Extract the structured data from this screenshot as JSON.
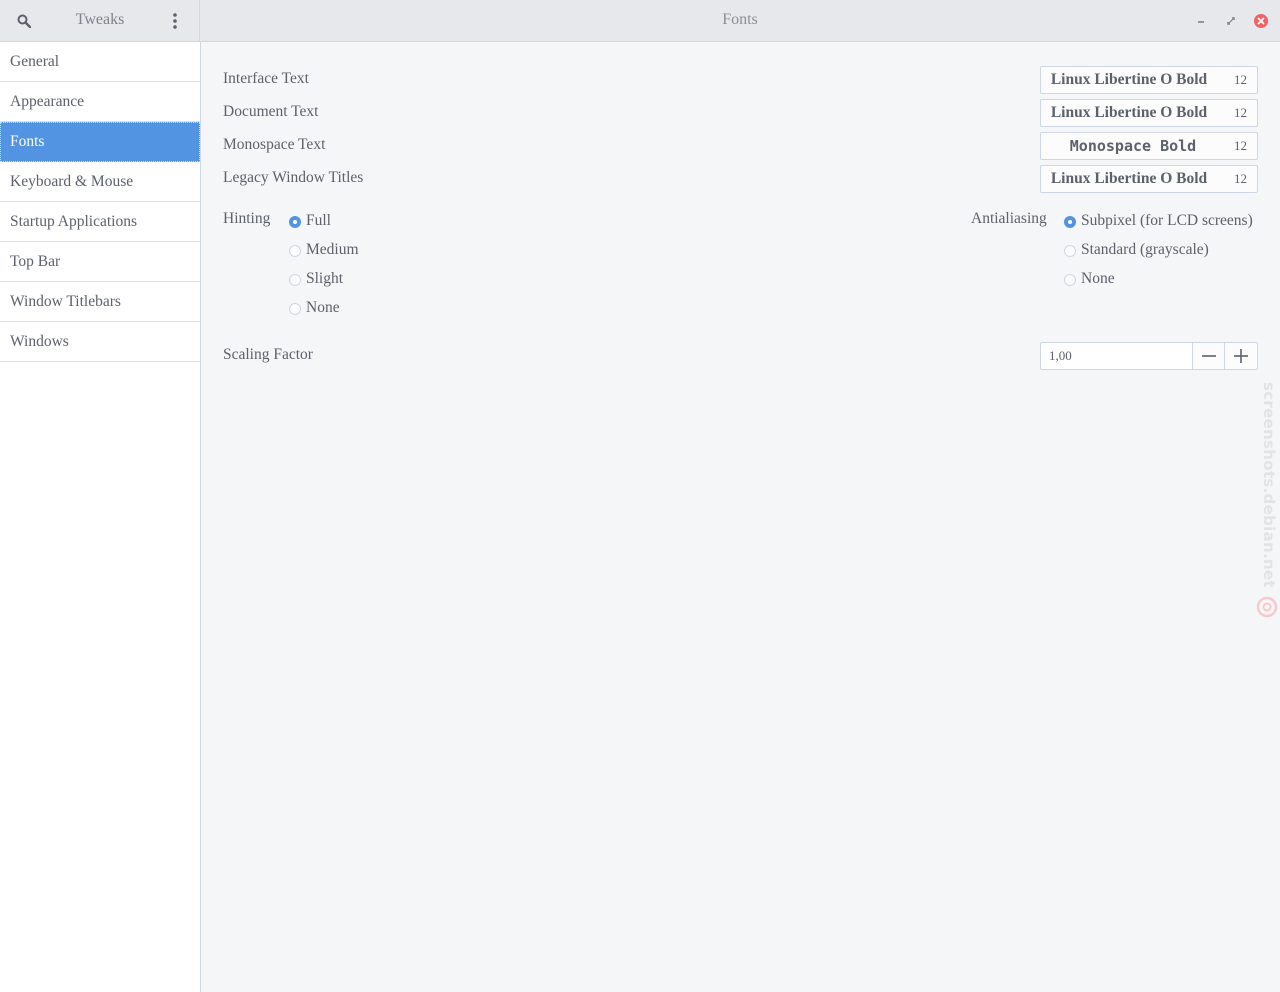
{
  "header": {
    "app_title": "Tweaks",
    "page_title": "Fonts"
  },
  "sidebar": {
    "items": [
      {
        "label": "General"
      },
      {
        "label": "Appearance"
      },
      {
        "label": "Fonts",
        "selected": true
      },
      {
        "label": "Keyboard & Mouse"
      },
      {
        "label": "Startup Applications"
      },
      {
        "label": "Top Bar"
      },
      {
        "label": "Window Titlebars"
      },
      {
        "label": "Windows"
      }
    ]
  },
  "fonts": {
    "interface": {
      "label": "Interface Text",
      "font": "Linux Libertine O Bold",
      "size": "12"
    },
    "document": {
      "label": "Document Text",
      "font": "Linux Libertine O Bold",
      "size": "12"
    },
    "monospace": {
      "label": "Monospace Text",
      "font": "Monospace Bold",
      "size": "12"
    },
    "legacy": {
      "label": "Legacy Window Titles",
      "font": "Linux Libertine O Bold",
      "size": "12"
    }
  },
  "hinting": {
    "label": "Hinting",
    "options": [
      "Full",
      "Medium",
      "Slight",
      "None"
    ],
    "selected": "Full"
  },
  "antialiasing": {
    "label": "Antialiasing",
    "options": [
      "Subpixel (for LCD screens)",
      "Standard (grayscale)",
      "None"
    ],
    "selected": "Subpixel (for LCD screens)"
  },
  "scaling": {
    "label": "Scaling Factor",
    "value": "1,00"
  },
  "watermark": {
    "text": "screenshots.debian.net"
  },
  "colors": {
    "accent": "#5294e2",
    "close": "#f46067",
    "text": "#5c616c",
    "background": "#f5f6f7"
  },
  "icons": {
    "search": "search-icon",
    "menu": "vertical-dots-icon",
    "minimize": "minimize-icon",
    "maximize": "maximize-icon",
    "close": "close-icon"
  }
}
